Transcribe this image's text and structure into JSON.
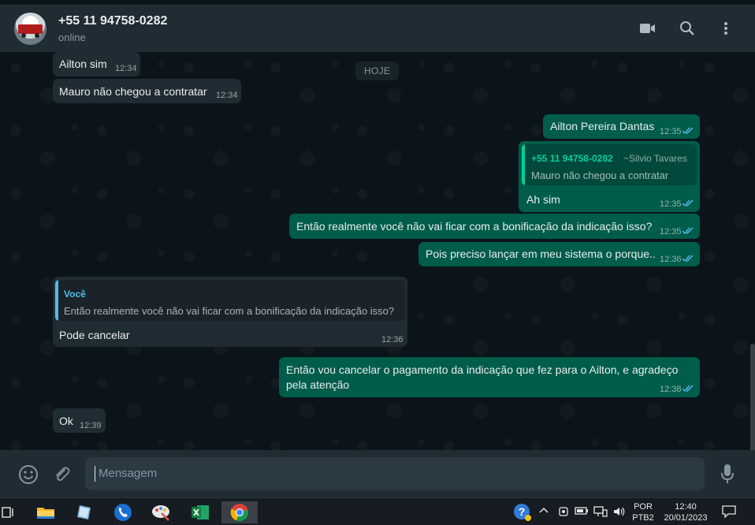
{
  "header": {
    "contact_name": "+55 11 94758-0282",
    "status": "online",
    "icons": [
      "video-call-icon",
      "search-icon",
      "menu-icon"
    ]
  },
  "chat": {
    "date_chip": "HOJE",
    "messages": [
      {
        "dir": "in",
        "text": "Ailton sim",
        "time": "12:34"
      },
      {
        "dir": "in",
        "text": "Mauro não chegou a contratar",
        "time": "12:34"
      },
      {
        "dir": "out",
        "text": "Ailton Pereira Dantas",
        "time": "12:35",
        "status": "read"
      },
      {
        "dir": "out",
        "quote": {
          "author": "+55 11 94758-0282",
          "alias": "~Silvio Tavares",
          "text": "Mauro não chegou a contratar"
        },
        "text": "Ah sim",
        "time": "12:35",
        "status": "read"
      },
      {
        "dir": "out",
        "text": "Então realmente você não vai  ficar com a bonificação da indicação isso?",
        "time": "12:35",
        "status": "read"
      },
      {
        "dir": "out",
        "text": "Pois preciso lançar em meu sistema o porque..",
        "time": "12:36",
        "status": "read"
      },
      {
        "dir": "in",
        "quote": {
          "author": "Você",
          "text": "Então realmente você não vai  ficar com a bonificação da indicação isso?"
        },
        "text": "Pode cancelar",
        "time": "12:36"
      },
      {
        "dir": "out",
        "text_line1": "Então vou cancelar o pagamento da indicação que fez para o Ailton, e agradeço",
        "text_line2": "pela atenção",
        "time": "12:38",
        "status": "read"
      },
      {
        "dir": "in",
        "text": "Ok",
        "time": "12:39"
      }
    ]
  },
  "composer": {
    "placeholder": "Mensagem",
    "icons": [
      "emoji-icon",
      "attach-icon",
      "microphone-icon"
    ]
  },
  "taskbar": {
    "apps": [
      "task-view-icon",
      "file-explorer-icon",
      "notepad-icon",
      "phone-app-icon",
      "paint-icon",
      "excel-icon",
      "chrome-icon"
    ],
    "language_line1": "POR",
    "language_line2": "PTB2",
    "clock_time": "12:40",
    "clock_date": "20/01/2023"
  },
  "colors": {
    "header_bg": "#202c33",
    "chat_bg": "#0b141a",
    "incoming_bubble": "#202c33",
    "outgoing_bubble": "#005c4b",
    "read_ticks": "#53bdeb",
    "quote_green": "#06cf9c",
    "quote_blue": "#53bdeb"
  }
}
